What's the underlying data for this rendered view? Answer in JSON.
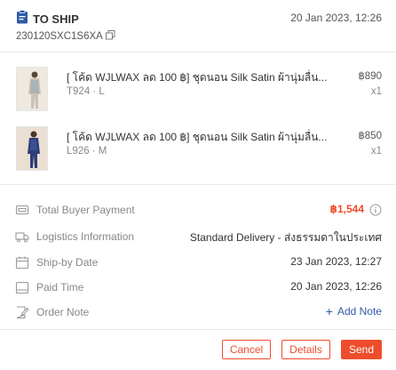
{
  "order": {
    "status": "TO SHIP",
    "time": "20 Jan 2023, 12:26",
    "id": "230120SXC1S6XA"
  },
  "products": [
    {
      "title": "[ โค้ด WJLWAX ลด 100 ฿] ชุดนอน Silk Satin ผ้านุ่มลื่น...",
      "variant": "T924 · L",
      "price": "฿890",
      "qty": "x1"
    },
    {
      "title": "[ โค้ด WJLWAX ลด 100 ฿] ชุดนอน Silk Satin ผ้านุ่มลื่น...",
      "variant": "L926 · M",
      "price": "฿850",
      "qty": "x1"
    }
  ],
  "info": {
    "payment_label": "Total Buyer Payment",
    "payment_value": "฿1,544",
    "logistics_label": "Logistics Information",
    "logistics_value": "Standard Delivery - ส่งธรรมดาในประเทศ",
    "shipby_label": "Ship-by Date",
    "shipby_value": "23 Jan 2023, 12:27",
    "paid_label": "Paid Time",
    "paid_value": "20 Jan 2023, 12:26",
    "note_label": "Order Note",
    "add_note_label": "Add Note"
  },
  "actions": {
    "cancel": "Cancel",
    "details": "Details",
    "send": "Send"
  },
  "colors": {
    "accent": "#ee4d2d",
    "status_icon": "#2f5ba6",
    "link": "#2f5ba6"
  }
}
